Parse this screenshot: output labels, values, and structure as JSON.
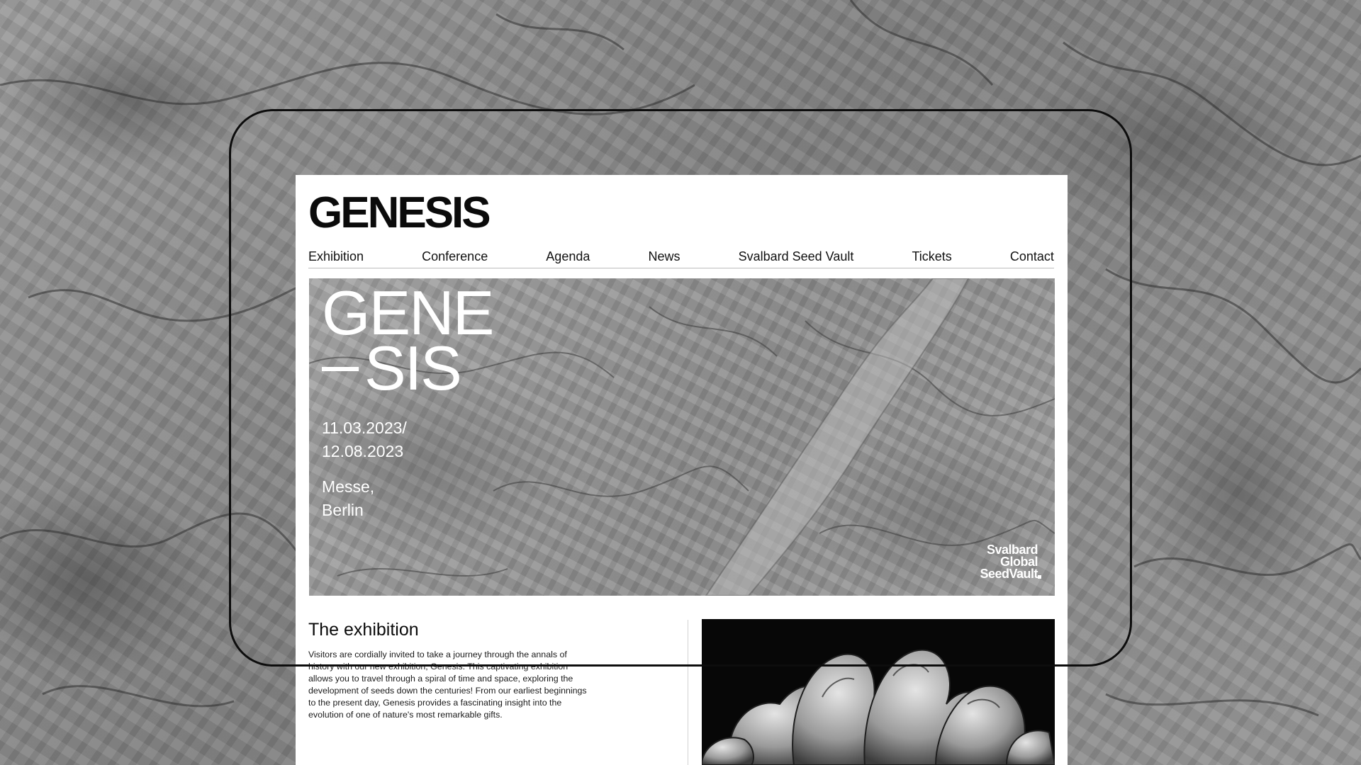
{
  "site": {
    "brand": "GENESIS"
  },
  "nav": {
    "items": [
      "Exhibition",
      "Conference",
      "Agenda",
      "News",
      "Svalbard Seed Vault",
      "Tickets",
      "Contact"
    ]
  },
  "hero": {
    "title_line1": "GENE",
    "title_line2": "SIS",
    "date_start": "11.03.2023/",
    "date_end": "12.08.2023",
    "place_line1": "Messe,",
    "place_line2": "Berlin",
    "partner_line1": "Svalbard",
    "partner_line2": "Global",
    "partner_line3": "SeedVault"
  },
  "exhibition": {
    "heading": "The exhibition",
    "body": "Visitors are cordially invited to take a journey through the annals of history with our new exhibition, Genesis. This captivating exhibition allows you to travel through a spiral of time and space, exploring the development of seeds down the centuries! From our earliest beginnings to the present day, Genesis provides a fascinating insight into the evolution of one of nature's most remarkable gifts."
  },
  "colors": {
    "page_bg": "#ffffff",
    "text": "#0b0b0b",
    "backdrop": "#8e8e8e",
    "frame_outline": "#0d0d0d"
  }
}
